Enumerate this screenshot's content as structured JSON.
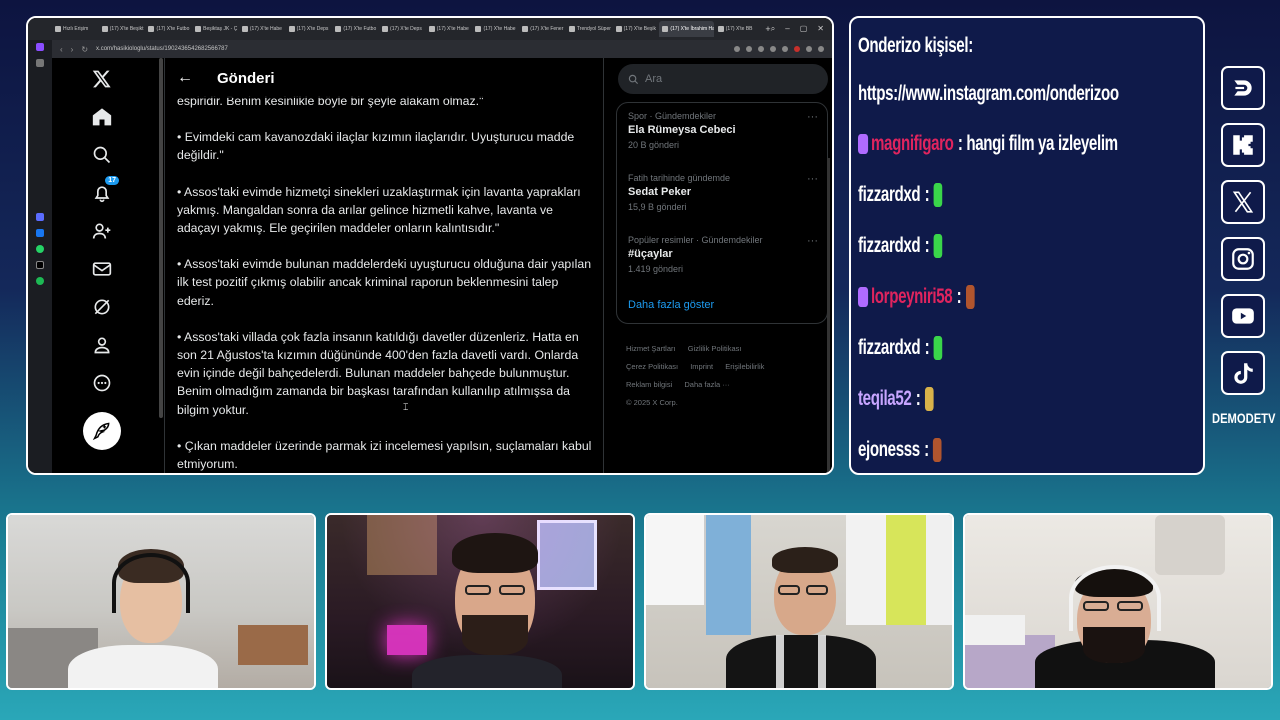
{
  "browser": {
    "tabs": [
      "Hızlı Erişim",
      "(17) X'te Beşikt",
      "(17) X'te Futbo",
      "Beşiktaş JK - Ç",
      "(17) X'te Habe",
      "(17) X'te Deps",
      "(17) X'te Futbo",
      "(17) X'te Deps",
      "(17) X'te Habe",
      "(17) X'te Habe",
      "(17) X'te Fener",
      "Trendyol Süper",
      "(17) X'te Beşik",
      "(17) X'te İbrahim Hakkı",
      "(17) X'te BB"
    ],
    "url": "x.com/hasikiologlu/status/1902436542682566787"
  },
  "x": {
    "header_title": "Gönderi",
    "notification_count": "17",
    "tweet_paragraphs": [
      "espiridir. Benim kesinlikle böyle bir şeyle alakam olmaz.\"",
      "• Evimdeki cam kavanozdaki ilaçlar kızımın ilaçlarıdır. Uyuşturucu madde değildir.\"",
      "• Assos'taki evimde hizmetçi sinekleri uzaklaştırmak için lavanta yaprakları yakmış. Mangaldan sonra da arılar gelince hizmetli kahve, lavanta ve adaçayı yakmış. Ele geçirilen maddeler onların kalıntısıdır.\"",
      "• Assos'taki evimde bulunan maddelerdeki uyuşturucu olduğuna dair yapılan ilk test pozitif çıkmış olabilir ancak kriminal raporun beklenmesini talep ederiz.",
      "• Assos'taki villada çok fazla insanın katıldığı davetler düzenleriz. Hatta en son 21 Ağustos'ta kızımın düğününde 400'den fazla davetli vardı. Onlarda evin içinde değil bahçedelerdi. Bulunan maddeler bahçede bulunmuştur. Benim olmadığım zamanda bir başkası tarafından kullanılıp atılmışsa da bilgim yoktur.",
      "• Çıkan maddeler üzerinde parmak izi incelemesi yapılsın, suçlamaları kabul etmiyorum."
    ],
    "search_placeholder": "Ara",
    "trends": [
      {
        "category": "Spor · Gündemdekiler",
        "name": "Ela Rümeysa Cebeci",
        "count": "20 B gönderi"
      },
      {
        "category": "Fatih tarihinde gündemde",
        "name": "Sedat Peker",
        "count": "15,9 B gönderi"
      },
      {
        "category": "Popüler resimler · Gündemdekiler",
        "name": "#üçaylar",
        "count": "1.419 gönderi"
      }
    ],
    "show_more": "Daha fazla göster",
    "footer_links": [
      "Hizmet Şartları",
      "Gizlilik Politikası",
      "Çerez Politikası",
      "Imprint",
      "Erişilebilirlik",
      "Reklam bilgisi",
      "Daha fazla ···"
    ],
    "copyright": "© 2025 X Corp."
  },
  "chat": {
    "header_line": "Onderizo kişisel:",
    "link_line": "https://www.instagram.com/onderizoo",
    "messages": [
      {
        "user": "magnifigaro",
        "text": ": hangi film ya izleyelim",
        "color": "#e0245e",
        "badge": true,
        "emote": ""
      },
      {
        "user": "fizzardxd",
        "text": ":",
        "color": "#ffffff",
        "badge": false,
        "emote": "#3ad64a"
      },
      {
        "user": "fizzardxd",
        "text": ":",
        "color": "#ffffff",
        "badge": false,
        "emote": "#3ad64a"
      },
      {
        "user": "lorpeyniri58",
        "text": ":",
        "color": "#e0245e",
        "badge": true,
        "emote": "#b0552e"
      },
      {
        "user": "fizzardxd",
        "text": ":",
        "color": "#ffffff",
        "badge": false,
        "emote": "#3ad64a"
      },
      {
        "user": "teqila52",
        "text": ":",
        "color": "#c7a5ff",
        "badge": false,
        "emote": "#d8b24a"
      },
      {
        "user": "ejonesss",
        "text": ":",
        "color": "#ffffff",
        "badge": false,
        "emote": "#b0552e"
      }
    ]
  },
  "social": {
    "icons": [
      "dlive-icon",
      "kick-icon",
      "x-icon",
      "instagram-icon",
      "youtube-icon",
      "tiktok-icon"
    ],
    "channel_name": "DEMODETV"
  }
}
